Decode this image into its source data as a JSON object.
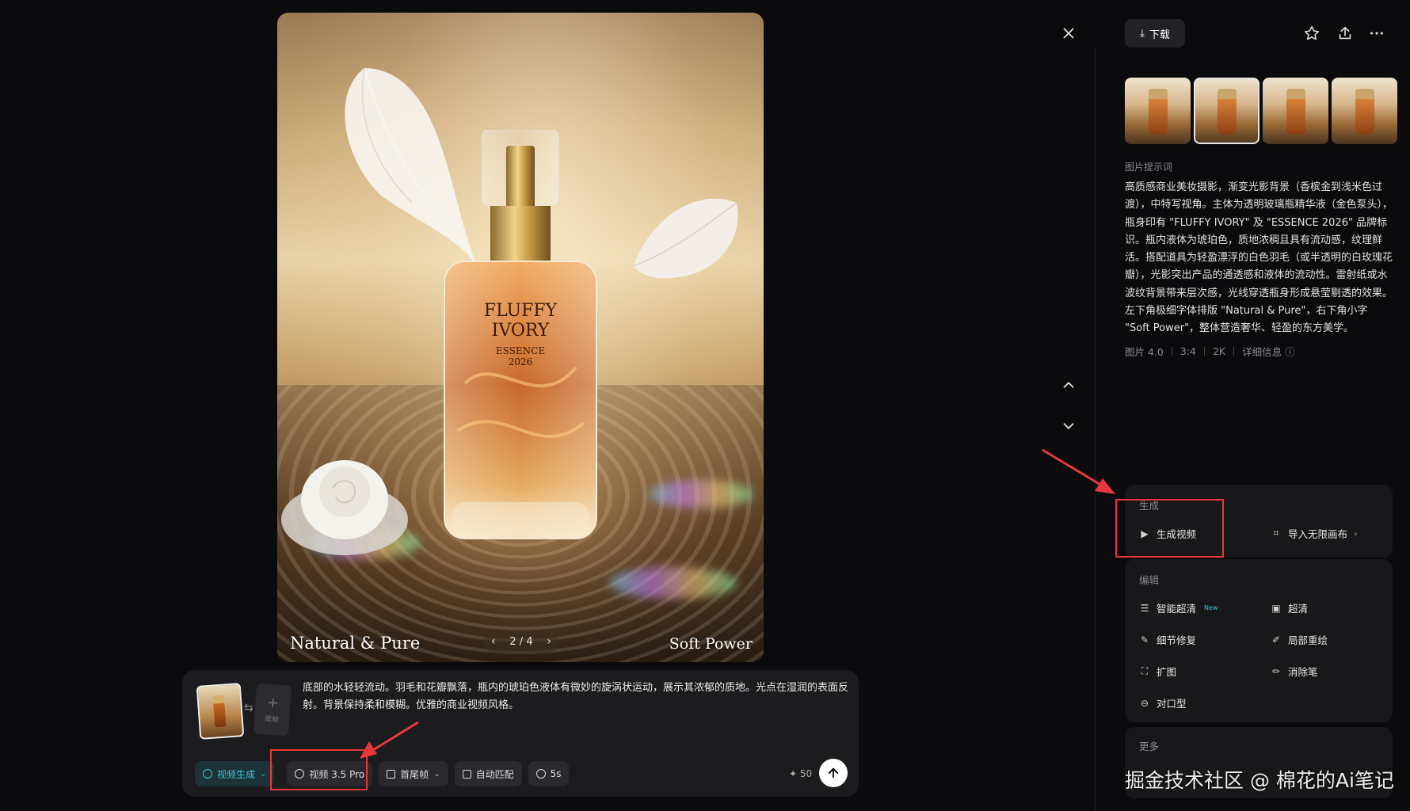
{
  "image": {
    "caption_left": "Natural & Pure",
    "caption_right": "Soft Power",
    "bottle_text": {
      "line1": "FLUFFY",
      "line2": "IVORY",
      "line3": "ESSENCE",
      "line4": "2026"
    },
    "pager": {
      "text": "2 / 4",
      "current": 2,
      "total": 4
    }
  },
  "composer": {
    "add_frame_label": "尾帧",
    "prompt": "底部的水轻轻流动。羽毛和花瓣飘落，瓶内的琥珀色液体有微妙的旋涡状运动，展示其浓郁的质地。光点在湿润的表面反射。背景保持柔和模糊。优雅的商业视频风格。",
    "mode_label": "视频生成",
    "model_label": "视频 3.5 Pro",
    "frame_label": "首尾帧",
    "ratio_label": "自动匹配",
    "duration_label": "5s",
    "credits": "50"
  },
  "right_panel": {
    "download_label": "下载",
    "thumbnails_count": 4,
    "active_thumbnail": 2,
    "prompt_section_label": "图片提示词",
    "prompt_text": "高质感商业美妆摄影，渐变光影背景（香槟金到浅米色过渡），中特写视角。主体为透明玻璃瓶精华液（金色泵头），瓶身印有 \"FLUFFY IVORY\" 及 \"ESSENCE 2026\" 品牌标识。瓶内液体为琥珀色，质地浓稠且具有流动感，纹理鲜活。搭配道具为轻盈漂浮的白色羽毛（或半透明的白玫瑰花瓣），光影突出产品的通透感和液体的流动性。雷射纸或水波纹背景带来层次感，光线穿透瓶身形成悬莹剔透的效果。左下角极细字体排版 \"Natural & Pure\"，右下角小字 \"Soft Power\"，整体营造奢华、轻盈的东方美学。",
    "meta": {
      "model": "图片 4.0",
      "ratio": "3:4",
      "resolution": "2K",
      "details": "详细信息"
    },
    "generate_section": {
      "title": "生成",
      "generate_video": "生成视频",
      "import_canvas": "导入无限画布"
    },
    "edit_section": {
      "title": "编辑",
      "smart_upscale": "智能超清",
      "smart_upscale_badge": "New",
      "upscale": "超清",
      "detail_repair": "细节修复",
      "inpaint": "局部重绘",
      "expand": "扩图",
      "eraser": "消除笔",
      "lip_sync": "对口型"
    },
    "more_section": {
      "title": "更多"
    }
  },
  "watermark": "掘金技术社区 @ 棉花的Ai笔记",
  "colors": {
    "background": "#0b0b0d",
    "accent": "#3fc3d6",
    "highlight": "#e8383d"
  }
}
